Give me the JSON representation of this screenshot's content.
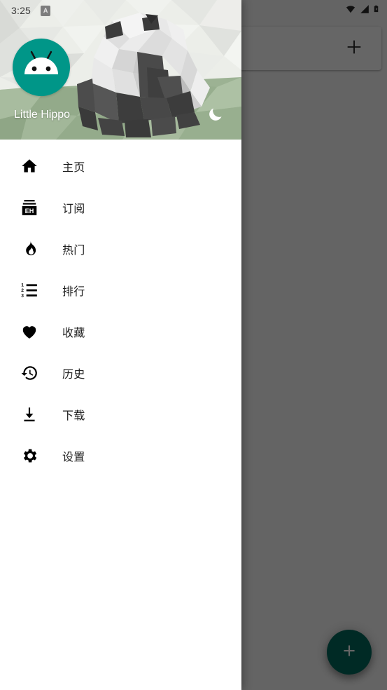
{
  "status_bar": {
    "time": "3:25",
    "alarm_badge": "A",
    "icons": [
      "wifi-icon",
      "cellular-signal-icon",
      "battery-charging-icon"
    ]
  },
  "background_app": {
    "search_bar": {
      "placeholder": ""
    },
    "add_button_label": "+",
    "add_button_icon": "plus-icon",
    "fab_icon": "plus-icon",
    "fab_label": "+",
    "fab_color": "#00695c",
    "scrim_color": "#666666"
  },
  "drawer": {
    "username": "Little Hippo",
    "avatar_icon": "android-robot-icon",
    "avatar_color": "#009688",
    "dark_mode_toggle_icon": "moon-icon",
    "header_art": "low-poly-panda-illustration",
    "items": [
      {
        "label": "主页",
        "icon": "home-icon",
        "name": "home"
      },
      {
        "label": "订阅",
        "icon": "eh-subscription-icon",
        "name": "subscription"
      },
      {
        "label": "热门",
        "icon": "flame-icon",
        "name": "popular"
      },
      {
        "label": "排行",
        "icon": "numbered-list-icon",
        "name": "ranking"
      },
      {
        "label": "收藏",
        "icon": "heart-icon",
        "name": "favorites"
      },
      {
        "label": "历史",
        "icon": "history-clock-icon",
        "name": "history"
      },
      {
        "label": "下载",
        "icon": "download-icon",
        "name": "downloads"
      },
      {
        "label": "设置",
        "icon": "gear-icon",
        "name": "settings"
      }
    ]
  }
}
